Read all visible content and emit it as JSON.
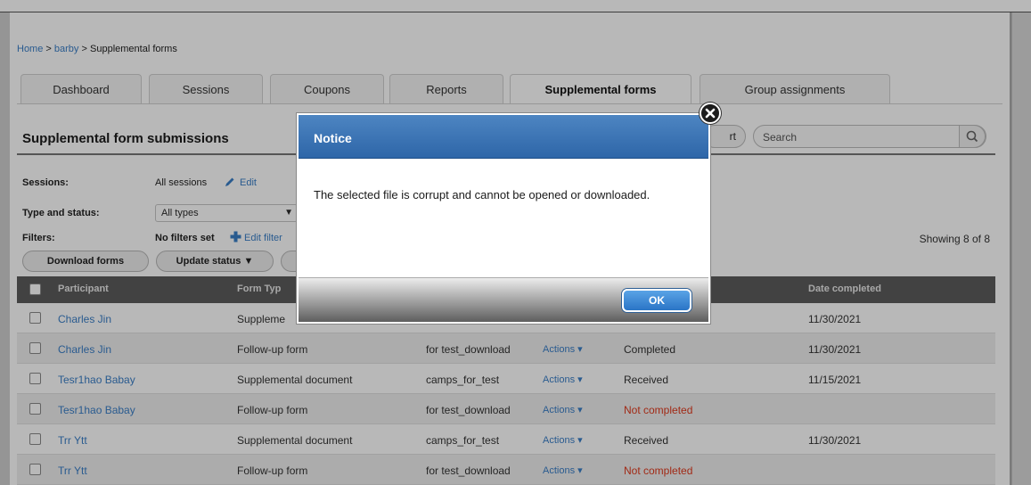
{
  "breadcrumb": {
    "home": "Home",
    "sep1": ">",
    "account": "barby",
    "sep2": ">",
    "current": "Supplemental forms"
  },
  "tabs": [
    {
      "label": "Dashboard"
    },
    {
      "label": "Sessions"
    },
    {
      "label": "Coupons"
    },
    {
      "label": "Reports"
    },
    {
      "label": "Supplemental forms"
    },
    {
      "label": "Group assignments"
    }
  ],
  "panel": {
    "title": "Supplemental form submissions",
    "sort_label": "rt",
    "search_placeholder": "Search",
    "showing": "Showing 8 of 8"
  },
  "filters": {
    "sessions_label": "Sessions:",
    "sessions_value": "All sessions",
    "sessions_edit": "Edit",
    "type_label": "Type and status:",
    "type_value": "All types",
    "filters_label": "Filters:",
    "filters_value": "No filters set",
    "filters_edit": "Edit filter"
  },
  "buttons": {
    "download": "Download forms",
    "update_status": "Update status ▼"
  },
  "table": {
    "headers": {
      "participant": "Participant",
      "form_type": "Form Typ",
      "date_completed": "Date completed"
    },
    "rows": [
      {
        "participant": "Charles Jin",
        "form_type": "Suppleme",
        "session": "",
        "actions": "",
        "status": "",
        "date": "11/30/2021"
      },
      {
        "participant": "Charles Jin",
        "form_type": "Follow-up form",
        "session": "for test_download",
        "actions": "Actions ▾",
        "status": "Completed",
        "date": "11/30/2021"
      },
      {
        "participant": "Tesr1hao Babay",
        "form_type": "Supplemental document",
        "session": "camps_for_test",
        "actions": "Actions ▾",
        "status": "Received",
        "date": "11/15/2021"
      },
      {
        "participant": "Tesr1hao Babay",
        "form_type": "Follow-up form",
        "session": "for test_download",
        "actions": "Actions ▾",
        "status": "Not completed",
        "date": ""
      },
      {
        "participant": "Trr Ytt",
        "form_type": "Supplemental document",
        "session": "camps_for_test",
        "actions": "Actions ▾",
        "status": "Received",
        "date": "11/30/2021"
      },
      {
        "participant": "Trr Ytt",
        "form_type": "Follow-up form",
        "session": "for test_download",
        "actions": "Actions ▾",
        "status": "Not completed",
        "date": ""
      }
    ]
  },
  "modal": {
    "title": "Notice",
    "message": "The selected file is corrupt and cannot be opened or downloaded.",
    "ok_label": "OK"
  },
  "icons": {
    "edit": "pencil-icon",
    "add_filter": "plus-icon",
    "search": "magnifier-icon",
    "close": "close-icon"
  },
  "colors": {
    "link": "#3a7ec7",
    "modal_header": "#3a73b4",
    "not_completed": "#e03a1e",
    "table_header": "#5c5c5c"
  }
}
